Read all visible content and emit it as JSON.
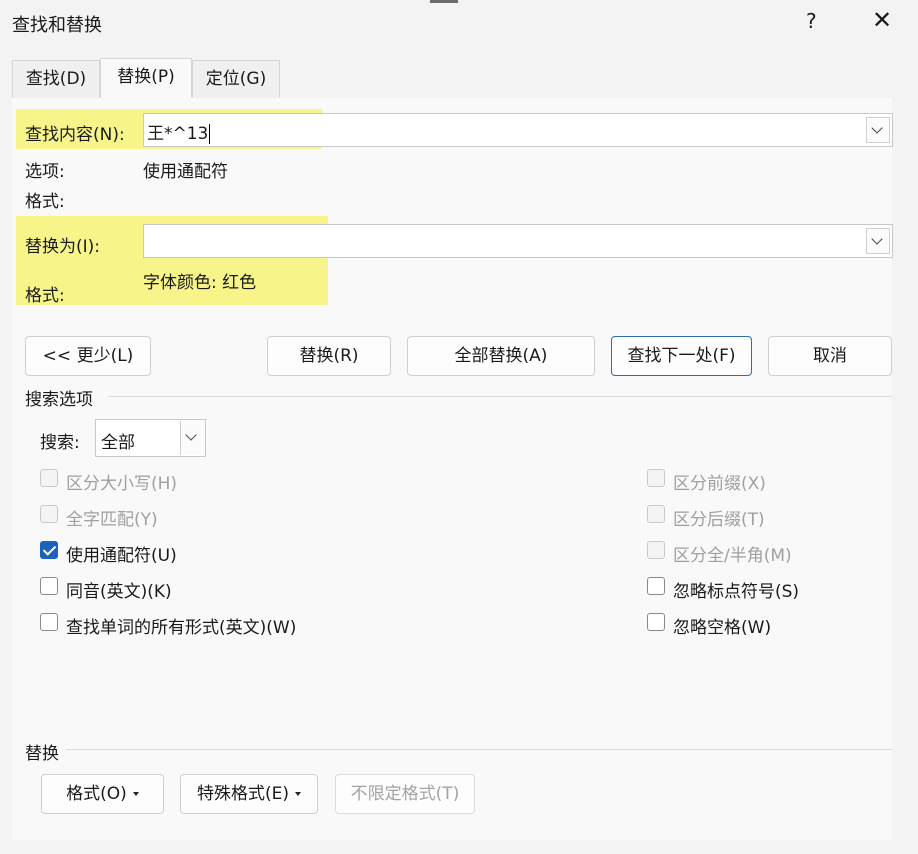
{
  "window": {
    "title": "查找和替换",
    "help": "?",
    "close": "✕"
  },
  "tabs": [
    {
      "label": "查找(D)"
    },
    {
      "label": "替换(P)"
    },
    {
      "label": "定位(G)"
    }
  ],
  "find": {
    "label": "查找内容(N):",
    "value": "王*^13",
    "options_label": "选项:",
    "options_value": "使用通配符",
    "format_label": "格式:",
    "format_value": ""
  },
  "replace": {
    "label": "替换为(I):",
    "value": "",
    "format_label": "格式:",
    "format_value": "字体颜色: 红色"
  },
  "buttons": {
    "less": "<< 更少(L)",
    "replace": "替换(R)",
    "replace_all": "全部替换(A)",
    "find_next": "查找下一处(F)",
    "cancel": "取消"
  },
  "search_options": {
    "section_title": "搜索选项",
    "search_label": "搜索:",
    "search_value": "全部",
    "left": [
      {
        "label": "区分大小写(H)",
        "checked": false,
        "disabled": true
      },
      {
        "label": "全字匹配(Y)",
        "checked": false,
        "disabled": true
      },
      {
        "label": "使用通配符(U)",
        "checked": true,
        "disabled": false
      },
      {
        "label": "同音(英文)(K)",
        "checked": false,
        "disabled": false
      },
      {
        "label": "查找单词的所有形式(英文)(W)",
        "checked": false,
        "disabled": false
      }
    ],
    "right": [
      {
        "label": "区分前缀(X)",
        "checked": false,
        "disabled": true
      },
      {
        "label": "区分后缀(T)",
        "checked": false,
        "disabled": true
      },
      {
        "label": "区分全/半角(M)",
        "checked": false,
        "disabled": true
      },
      {
        "label": "忽略标点符号(S)",
        "checked": false,
        "disabled": false
      },
      {
        "label": "忽略空格(W)",
        "checked": false,
        "disabled": false
      }
    ]
  },
  "replace_section": {
    "title": "替换",
    "format_button": "格式(O)",
    "special_button": "特殊格式(E)",
    "no_format_button": "不限定格式(T)"
  },
  "colors": {
    "highlight": "#f7f589",
    "accent": "#1a63b8"
  }
}
